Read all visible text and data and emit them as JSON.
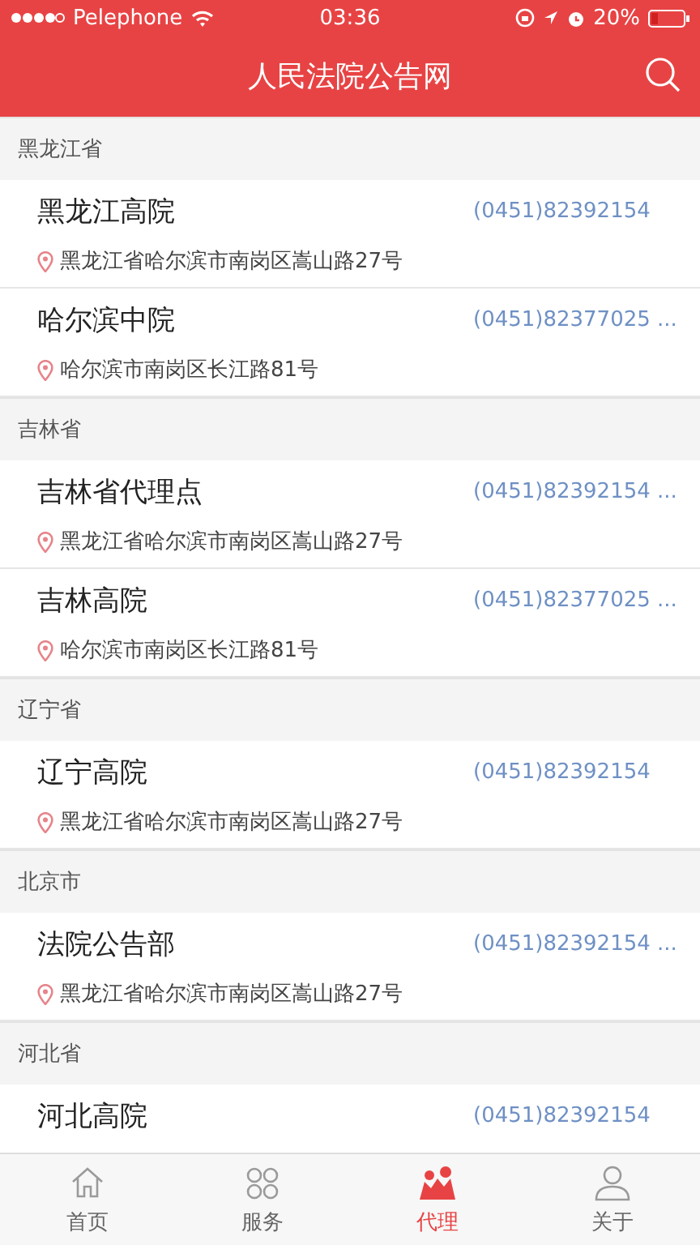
{
  "status_bar": {
    "carrier": "Pelephone",
    "time": "03:36",
    "battery": "20%"
  },
  "nav": {
    "title": "人民法院公告网"
  },
  "sections": [
    {
      "title": "黑龙江省",
      "items": [
        {
          "name": "黑龙江高院",
          "phone": "(0451)82392154",
          "address": "黑龙江省哈尔滨市南岗区嵩山路27号"
        },
        {
          "name": "哈尔滨中院",
          "phone": "(0451)82377025 ...",
          "address": "哈尔滨市南岗区长江路81号"
        }
      ]
    },
    {
      "title": "吉林省",
      "items": [
        {
          "name": "吉林省代理点",
          "phone": "(0451)82392154 ...",
          "address": "黑龙江省哈尔滨市南岗区嵩山路27号"
        },
        {
          "name": "吉林高院",
          "phone": "(0451)82377025 ...",
          "address": "哈尔滨市南岗区长江路81号"
        }
      ]
    },
    {
      "title": "辽宁省",
      "items": [
        {
          "name": "辽宁高院",
          "phone": "(0451)82392154",
          "address": "黑龙江省哈尔滨市南岗区嵩山路27号"
        }
      ]
    },
    {
      "title": "北京市",
      "items": [
        {
          "name": "法院公告部",
          "phone": "(0451)82392154 ...",
          "address": "黑龙江省哈尔滨市南岗区嵩山路27号"
        }
      ]
    },
    {
      "title": "河北省",
      "items": [
        {
          "name": "河北高院",
          "phone": "(0451)82392154"
        }
      ]
    }
  ],
  "tabs": [
    {
      "label": "首页",
      "kind": "home",
      "selected": false
    },
    {
      "label": "服务",
      "kind": "services",
      "selected": false
    },
    {
      "label": "代理",
      "kind": "agency",
      "selected": true
    },
    {
      "label": "关于",
      "kind": "about",
      "selected": false
    }
  ]
}
